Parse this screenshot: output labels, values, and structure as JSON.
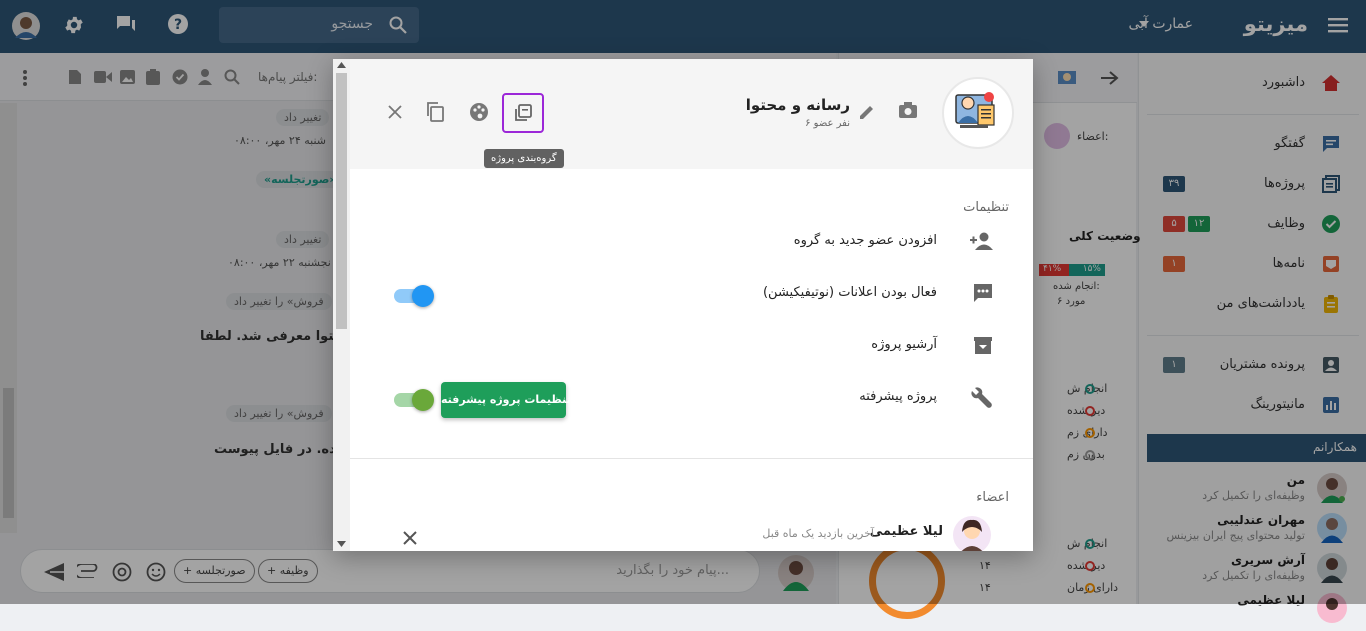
{
  "topbar": {
    "brand": "میزیتو",
    "company": "عمارت آبی",
    "search_placeholder": "جستجو"
  },
  "sidebar": {
    "items": [
      {
        "label": "داشبورد"
      },
      {
        "label": "گفتگو"
      },
      {
        "label": "پروژه‌ها",
        "badges": [
          "۳۹"
        ]
      },
      {
        "label": "وظایف",
        "badges": [
          "۱۲",
          "۵"
        ]
      },
      {
        "label": "نامه‌ها",
        "badges": [
          "۱"
        ]
      },
      {
        "label": "یادداشت‌های من"
      },
      {
        "label": "پرونده مشتریان",
        "badges": [
          "۱"
        ]
      },
      {
        "label": "مانیتورینگ"
      }
    ],
    "colleagues_title": "همکارانم",
    "colleagues": [
      {
        "name": "من",
        "status": "وظیفه‌ای را تکمیل کرد"
      },
      {
        "name": "مهران عندلیبی",
        "status": "تولید محتوای پیج ایران بیزینس"
      },
      {
        "name": "آرش سریری",
        "status": "وظیفه‌ای را تکمیل کرد"
      },
      {
        "name": "لیلا عظیمی",
        "status": ""
      }
    ],
    "badge_colors": {
      "projects": "#2e5778",
      "tasks_green": "#1e9e5a",
      "tasks_red": "#e0483c",
      "letters": "#e8683a",
      "customers": "#607d8b"
    }
  },
  "middle": {
    "members_label": "اعضاء:",
    "status_title": "وضعیت کلی",
    "bar_labels": [
      "۱۵%",
      "۴۱%"
    ],
    "done_label": "انجام شده:",
    "count_label": "۶ مورد",
    "legend": [
      "انجام ش",
      "دیر شده",
      "دارای زم",
      "بدون زم"
    ],
    "legend2": [
      {
        "label": "انجام ش",
        "value": ""
      },
      {
        "label": "دیر شده",
        "value": "۱۴"
      },
      {
        "label": "دارای زمان",
        "value": "۱۴"
      }
    ]
  },
  "chat": {
    "filter_placeholder": "فیلتر پیام‌ها:",
    "pills": [
      "تغییر داد",
      "تغییر داد",
      "فروش» را تغییر داد",
      "فروش» را تغییر داد"
    ],
    "dates": [
      "شنبه ۲۴ مهر، ۰۸:۰۰",
      "نجشنبه ۲۲ مهر، ۰۸:۰۰"
    ],
    "tag": "«صورتجلسه»",
    "msg1": "محتوا معرفی شد. لطفا",
    "msg2": "شده. در فایل پیوست",
    "composer_placeholder": "پیام خود را بگذارید...",
    "chips": [
      "+ وظیفه",
      "+ صورتجلسه"
    ]
  },
  "modal": {
    "title": "رسانه و محتوا",
    "subtitle": "۶ نفر عضو",
    "tooltip": "گروه‌بندی پروژه",
    "settings_title": "تنظیمات",
    "rows": [
      {
        "label": "افزودن عضو جدید به گروه"
      },
      {
        "label": "فعال بودن اعلانات (نوتیفیکیشن)",
        "toggle": true
      },
      {
        "label": "آرشیو پروژه"
      },
      {
        "label": "پروژه پیشرفته",
        "toggle": true,
        "button": "تنظیمات پروژه پیشرفته"
      }
    ],
    "members_title": "اعضاء",
    "member": {
      "name": "لیلا عظیمی",
      "last_visit": "آخرین بازدید یک ماه قبل"
    },
    "colors": {
      "accent_purple": "#9c27d8",
      "toggle_blue": "#2196f3",
      "toggle_green": "#6aa83a",
      "button_green": "#1e9e5a"
    }
  }
}
